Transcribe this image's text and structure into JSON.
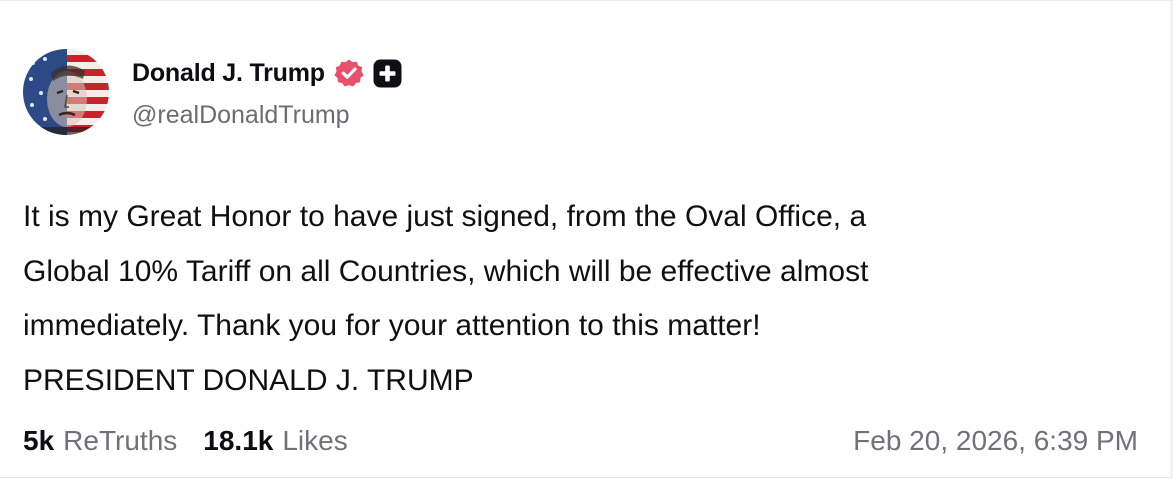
{
  "author": {
    "display_name": "Donald J. Trump",
    "handle": "@realDonaldTrump",
    "verified_badge_color": "#e8506b",
    "badges": [
      "verified-icon",
      "truth-plus-icon"
    ]
  },
  "post": {
    "lines": [
      "It is my Great Honor to have just signed, from the Oval Office, a",
      "Global 10% Tariff on all Countries, which will be effective almost",
      "immediately. Thank you for your attention to this matter!",
      "PRESIDENT DONALD J. TRUMP"
    ]
  },
  "stats": {
    "retruths_count": "5k",
    "retruths_label": "ReTruths",
    "likes_count": "18.1k",
    "likes_label": "Likes"
  },
  "timestamp": "Feb 20, 2026, 6:39 PM"
}
